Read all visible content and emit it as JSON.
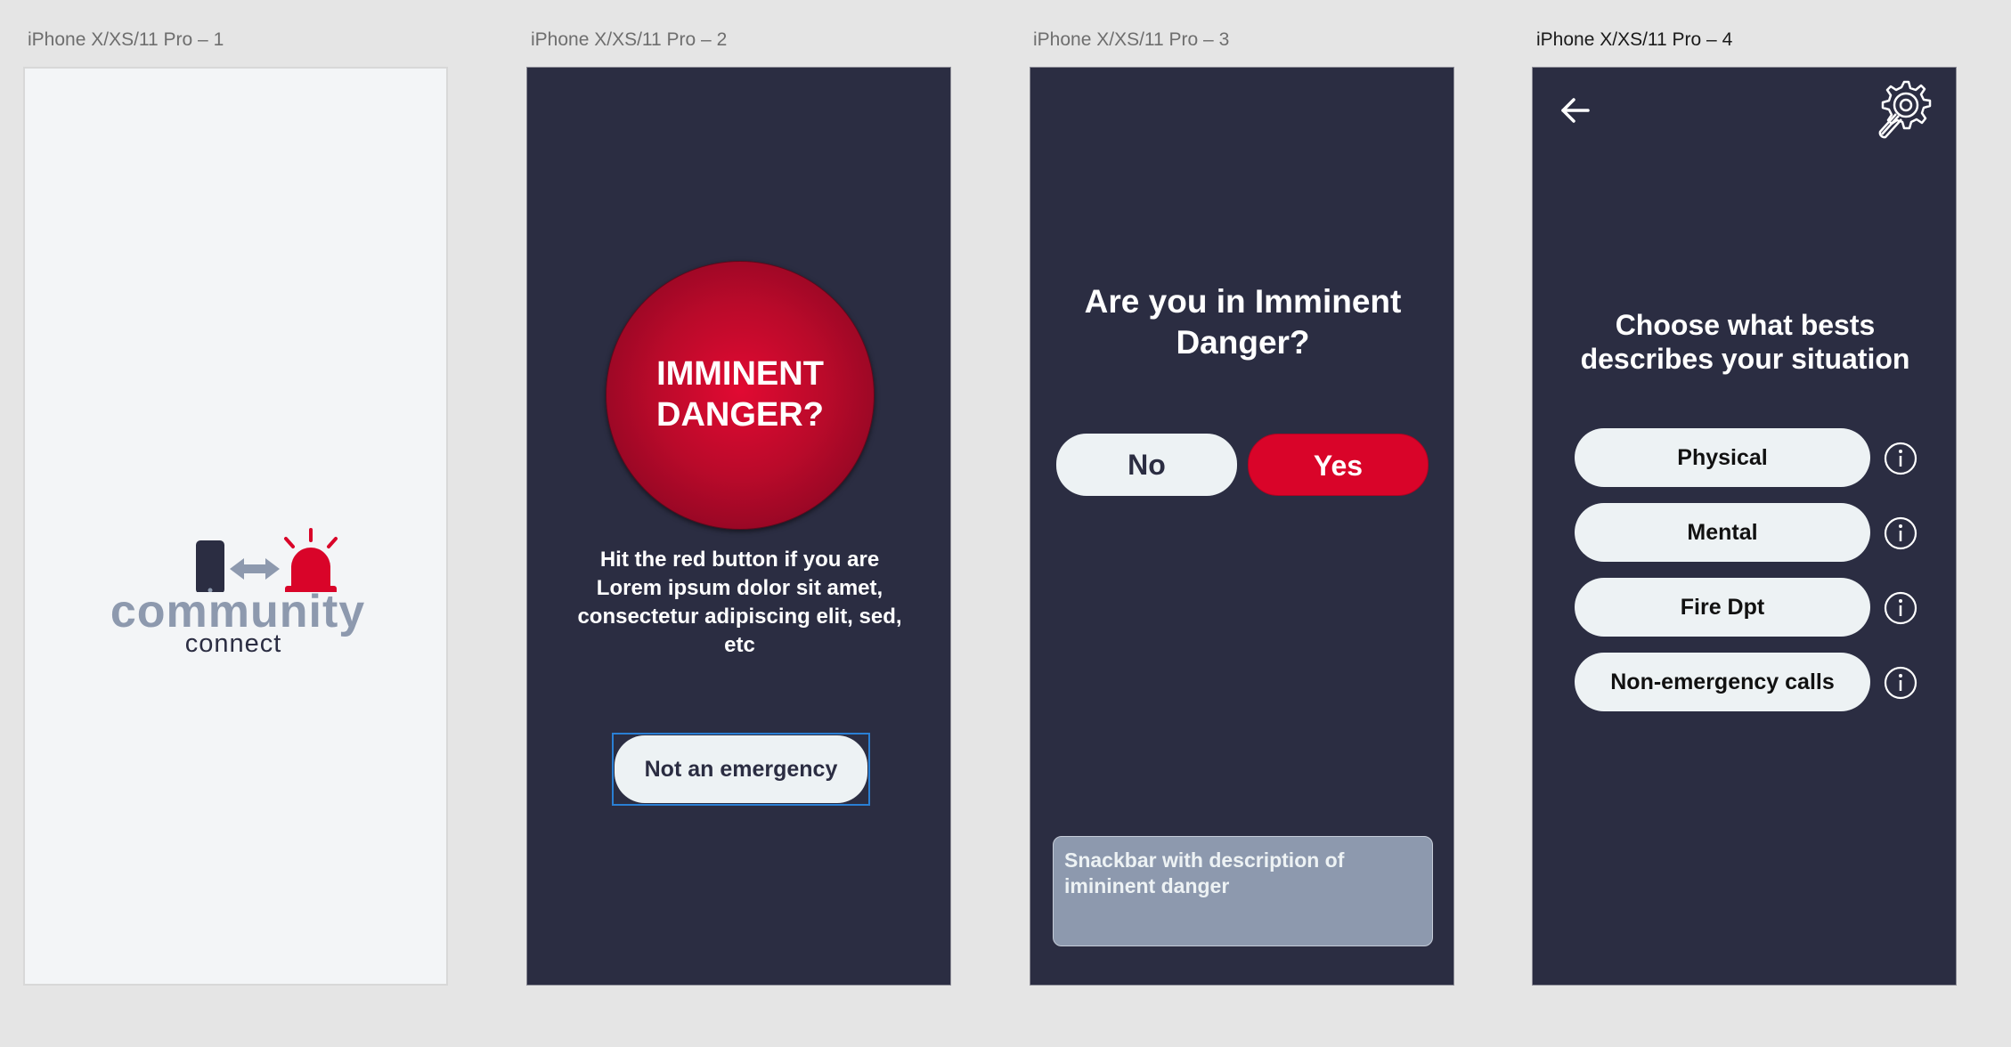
{
  "colors": {
    "canvas": "#e5e5e5",
    "dark_bg": "#2b2d42",
    "light_bg": "#f3f5f7",
    "accent_red": "#d90429",
    "slate": "#8d99ae",
    "pill_bg": "#edf2f4"
  },
  "artboards": [
    {
      "title": "iPhone X/XS/11 Pro – 1"
    },
    {
      "title": "iPhone X/XS/11 Pro – 2"
    },
    {
      "title": "iPhone X/XS/11 Pro – 3"
    },
    {
      "title": "iPhone X/XS/11 Pro – 4"
    }
  ],
  "screen1": {
    "logo": {
      "word": "community",
      "sub": "connect",
      "icons": [
        "phone-icon",
        "double-arrow-icon",
        "siren-icon"
      ]
    }
  },
  "screen2": {
    "danger_button_line1": "IMMINENT",
    "danger_button_line2": "DANGER?",
    "hint": "Hit the red button if you are Lorem ipsum dolor sit amet, consectetur adipiscing elit, sed, etc",
    "not_emergency_label": "Not an emergency"
  },
  "screen3": {
    "question": "Are you in Imminent Danger?",
    "no_label": "No",
    "yes_label": "Yes",
    "snackbar_text": "Snackbar with description of imininent danger"
  },
  "screen4": {
    "back_icon": "arrow-left-icon",
    "settings_icon": "gear-icon",
    "title": "Choose what bests describes  your situation",
    "options": [
      {
        "label": "Physical"
      },
      {
        "label": "Mental"
      },
      {
        "label": "Fire Dpt"
      },
      {
        "label": "Non-emergency calls"
      }
    ]
  }
}
